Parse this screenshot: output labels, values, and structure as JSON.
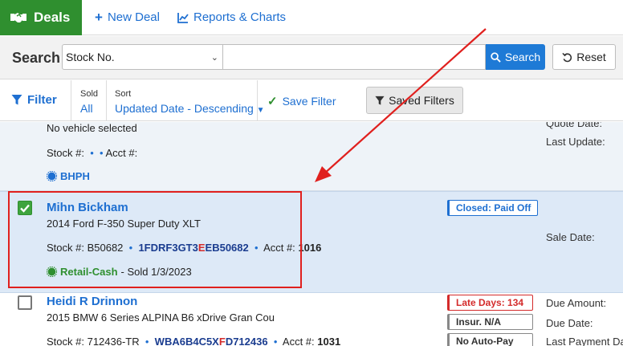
{
  "nav": {
    "brand": "Deals",
    "new_deal": "New Deal",
    "reports": "Reports & Charts"
  },
  "search": {
    "label": "Search",
    "field_select": "Stock No.",
    "query": "",
    "button": "Search",
    "reset": "Reset"
  },
  "filterbar": {
    "filter": "Filter",
    "sold_label": "Sold",
    "sold_value": "All",
    "sort_label": "Sort",
    "sort_value": "Updated Date - Descending",
    "save_filter": "Save Filter",
    "saved_filters": "Saved Filters"
  },
  "deals": [
    {
      "vehicle": "No vehicle selected",
      "stock_label": "Stock #:",
      "acct_label": "Acct #:",
      "tag": "BHPH",
      "right_labels": [
        "Quote Date:",
        "Last Update:"
      ]
    },
    {
      "customer": "Mihn Bickham",
      "vehicle": "2014 Ford F-350 Super Duty XLT",
      "stock_label": "Stock #:",
      "stock": "B50682",
      "vin_a": "1FDRF3GT3",
      "vin_b": "E",
      "vin_c": "EB50682",
      "acct_label": "Acct #:",
      "acct": "1016",
      "tag": "Retail-Cash",
      "sold": "- Sold 1/3/2023",
      "badge": "Closed: Paid Off",
      "right_labels": [
        "Sale Date:"
      ],
      "checked": true
    },
    {
      "customer": "Heidi R Drinnon",
      "vehicle": "2015 BMW 6 Series ALPINA B6 xDrive Gran Cou",
      "stock_label": "Stock #:",
      "stock": "712436-TR",
      "vin_a": "WBA6B4C5X",
      "vin_b": "F",
      "vin_c": "D712436",
      "acct_label": "Acct #:",
      "acct": "1031",
      "badges": [
        "Late Days: 134",
        "Insur. N/A",
        "No Auto-Pay"
      ],
      "right_labels": [
        "Due Amount:",
        "Due Date:",
        "Last Payment Date:"
      ],
      "checked": false
    }
  ],
  "colors": {
    "brand_green": "#2f8f2f",
    "link_blue": "#1e6fd1",
    "annotation_red": "#e0201e"
  }
}
